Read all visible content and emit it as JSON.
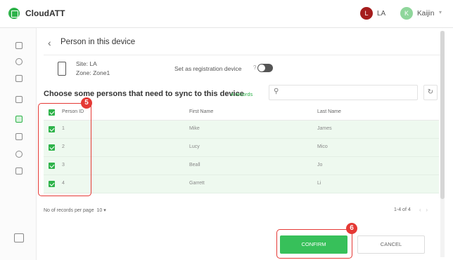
{
  "app": {
    "title": "CloudATT",
    "site_initial": "L",
    "site_name": "LA",
    "user_initial": "K",
    "user_name": "Kaijin"
  },
  "header": {
    "title": "Person in this device"
  },
  "device": {
    "site": "Site: LA",
    "zone": "Zone: Zone1",
    "registration_label": "Set as registration device"
  },
  "section": {
    "title": "Choose some persons that need to sync to this device",
    "records": "4 records"
  },
  "table": {
    "columns": [
      "Person ID",
      "First Name",
      "Last Name"
    ],
    "rows": [
      {
        "id": "1",
        "first": "Mike",
        "last": "James"
      },
      {
        "id": "2",
        "first": "Lucy",
        "last": "Mico"
      },
      {
        "id": "3",
        "first": "Beall",
        "last": "Jo"
      },
      {
        "id": "4",
        "first": "Garrett",
        "last": "Li"
      }
    ]
  },
  "pagination": {
    "per_page_label": "No of records per page",
    "per_page_value": "10",
    "range": "1-4 of 4"
  },
  "actions": {
    "confirm": "CONFIRM",
    "cancel": "CANCEL"
  },
  "annotations": {
    "badge_a": "5",
    "badge_b": "6"
  },
  "colors": {
    "brand": "#2eb34a",
    "annotation": "#e53935",
    "site_avatar": "#a51c1c",
    "user_avatar": "#8fd69b"
  }
}
